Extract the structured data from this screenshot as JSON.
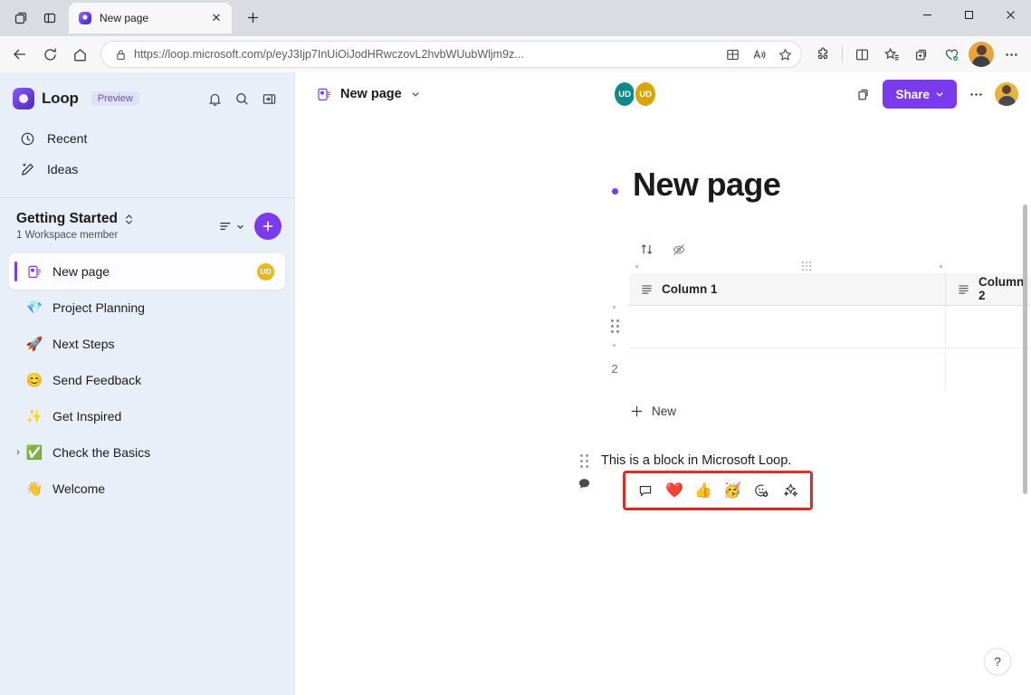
{
  "browser": {
    "tab": {
      "title": "New page",
      "favicon_icon": "loop-favicon",
      "close_icon": "close-icon"
    },
    "tab_actions": {
      "workspaces_icon": "tab-workspaces-icon",
      "tab_list_icon": "tab-list-icon",
      "new_tab_icon": "new-tab-icon",
      "new_tab_label": "+"
    },
    "window_controls": {
      "minimize": "—",
      "maximize": "☐",
      "close": "✕"
    },
    "nav": {
      "back_icon": "back-arrow-icon",
      "refresh_icon": "refresh-icon",
      "home_icon": "home-icon"
    },
    "omnibox": {
      "lock_icon": "site-information-icon",
      "url_prefix": "https://",
      "url_domain": "loop.microsoft.com",
      "url_path": "/p/eyJ3Ijp7InUiOiJodHHRwczovL2hvbWUubWljbTlz...",
      "url_full": "https://loop.microsoft.com/p/eyJ3Ijp7InUiOiJodHRwczovL2hvbWUubWljm9z...",
      "split_screen_icon": "split-screen-icon",
      "read_aloud_icon": "read-aloud-icon",
      "favorite_icon": "add-favorite-star-icon"
    },
    "toolbar_right": [
      {
        "name": "extensions-icon",
        "glyph": "puzzle"
      },
      {
        "name": "split-screen-icon",
        "glyph": "split"
      },
      {
        "name": "favorites-icon",
        "glyph": "star-list"
      },
      {
        "name": "collections-icon",
        "glyph": "collections"
      },
      {
        "name": "browser-essentials-icon",
        "glyph": "essentials"
      },
      {
        "name": "profile-avatar",
        "glyph": "avatar"
      },
      {
        "name": "settings-and-more-icon",
        "glyph": "ellipsis"
      }
    ]
  },
  "sidebar": {
    "brand": {
      "name": "Loop",
      "badge": "Preview",
      "logo_icon": "loop-logo-icon"
    },
    "brand_actions": [
      {
        "name": "notifications-bell-icon",
        "label": ""
      },
      {
        "name": "search-icon",
        "label": ""
      },
      {
        "name": "collapse-sidebar-icon",
        "label": ""
      }
    ],
    "nav_items": [
      {
        "label": "Recent",
        "icon": "clock-icon"
      },
      {
        "label": "Ideas",
        "icon": "pencil-sparkle-icon"
      }
    ],
    "workspace": {
      "title": "Getting Started",
      "subtitle": "1 Workspace member",
      "expand_icon": "chevron-updown-icon",
      "sort_icon": "sort-list-icon",
      "sort_chevron": "chevron-down-icon",
      "add_label": "+",
      "add_icon": "add-page-icon"
    },
    "pages": [
      {
        "label": "New page",
        "emoji": "",
        "icon": "loop-page-icon",
        "active": true,
        "badge": "UD",
        "has_chevron": false
      },
      {
        "label": "Project Planning",
        "emoji": "💎",
        "active": false,
        "badge": "",
        "has_chevron": false
      },
      {
        "label": "Next Steps",
        "emoji": "🚀",
        "active": false,
        "badge": "",
        "has_chevron": false
      },
      {
        "label": "Send Feedback",
        "emoji": "😊",
        "active": false,
        "badge": "",
        "has_chevron": false
      },
      {
        "label": "Get Inspired",
        "emoji": "✨",
        "active": false,
        "badge": "",
        "has_chevron": false
      },
      {
        "label": "Check the Basics",
        "emoji": "✅",
        "active": false,
        "badge": "",
        "has_chevron": true,
        "chevron": "›"
      },
      {
        "label": "Welcome",
        "emoji": "👋",
        "active": false,
        "badge": "",
        "has_chevron": false
      }
    ]
  },
  "main_header": {
    "page_icon": "loop-page-icon",
    "title": "New page",
    "chevron": "⌄",
    "avatars": [
      {
        "initials": "UD",
        "color": "#0f8a8a"
      },
      {
        "initials": "UD",
        "color": "#d8a600"
      }
    ],
    "copy_link_icon": "copy-link-icon",
    "share_label": "Share",
    "share_chevron": "⌄",
    "more_label": "⋯",
    "more_icon": "more-options-icon",
    "account_avatar_icon": "account-avatar"
  },
  "document": {
    "bullet_icon": "page-bullet",
    "title": "New page",
    "table": {
      "toolbar": [
        {
          "name": "sort-table-icon",
          "label": ""
        },
        {
          "name": "hide-columns-icon",
          "label": ""
        }
      ],
      "columns": [
        {
          "label": "Column 1",
          "type_icon": "text-column-icon"
        },
        {
          "label": "Column 2",
          "type_icon": "text-column-icon"
        }
      ],
      "rows": [
        {
          "number": "",
          "handle": "drag-handle",
          "cells": [
            "",
            ""
          ]
        },
        {
          "number": "2",
          "handle": "",
          "cells": [
            "",
            ""
          ]
        }
      ],
      "new_row_label": "New",
      "new_row_icon": "plus-icon"
    },
    "paragraph": {
      "text": "This is a block in Microsoft Loop.",
      "drag_handle_icon": "drag-handle-icon",
      "comment_icon": "comment-bubble-icon"
    },
    "reaction_toolbar": {
      "highlight_color": "#d9342b",
      "buttons": [
        {
          "name": "add-comment-icon",
          "glyph": "💬"
        },
        {
          "name": "heart-reaction-icon",
          "glyph": "❤️"
        },
        {
          "name": "thumbs-up-reaction-icon",
          "glyph": "👍"
        },
        {
          "name": "party-face-reaction-icon",
          "glyph": "🥳"
        },
        {
          "name": "add-reaction-icon",
          "glyph": "☺"
        },
        {
          "name": "sparkle-reaction-icon",
          "glyph": "✨"
        }
      ]
    }
  },
  "help": {
    "label": "?",
    "icon": "help-icon"
  }
}
